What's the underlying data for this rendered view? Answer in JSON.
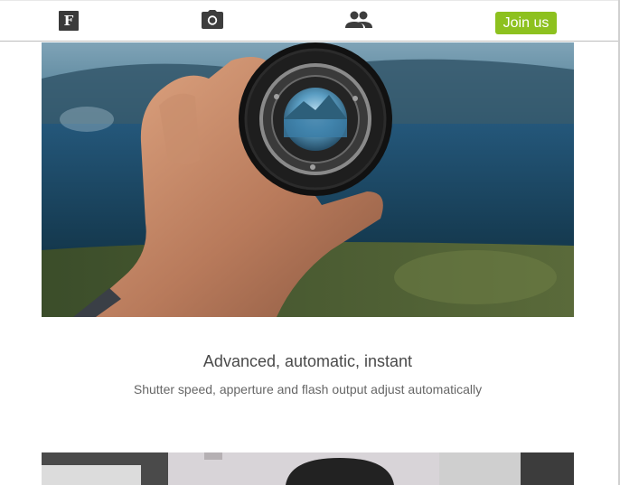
{
  "nav": {
    "logo_letter": "F",
    "logo_icon": "flickr-f-logo-icon",
    "camera_icon": "camera-icon",
    "people_icon": "group-icon",
    "join_label": "Join us",
    "accent_color": "#8dc11f"
  },
  "hero": {
    "image_icon": "hand-holding-camera-lens-photo"
  },
  "feature": {
    "title": "Advanced, automatic, instant",
    "description": "Shutter speed, apperture and flash output adjust automatically"
  },
  "next_section": {
    "image_icon": "camera-closeup-photo"
  }
}
